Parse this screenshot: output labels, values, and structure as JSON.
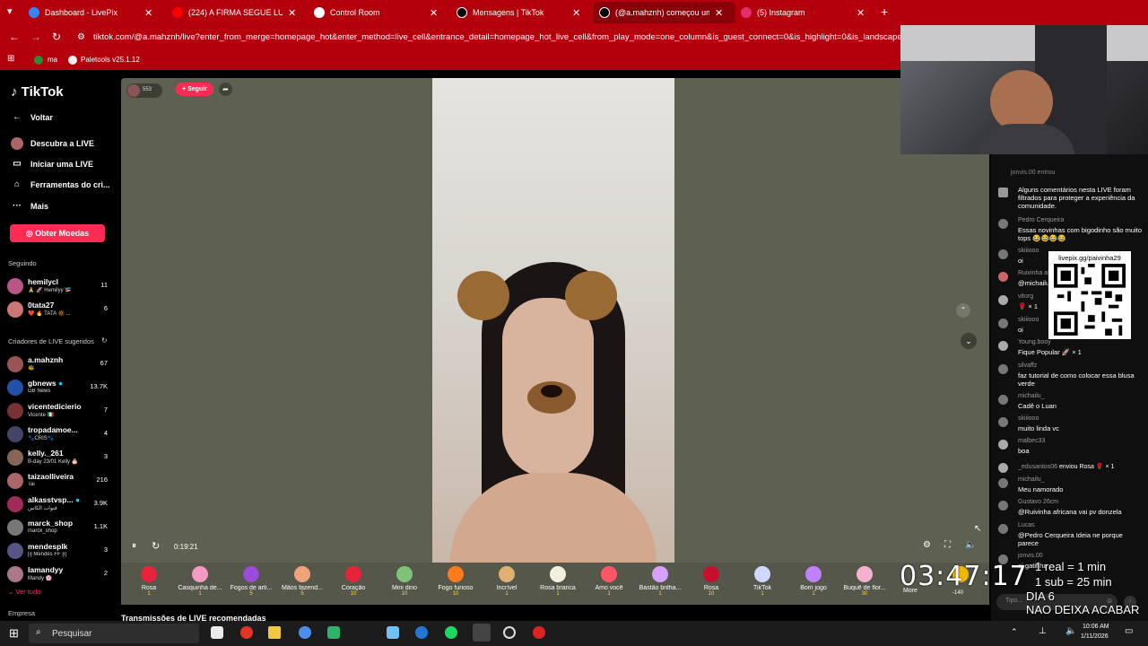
{
  "tabs": [
    {
      "label": "Dashboard - LivePix",
      "icon": "livepix-icon",
      "color": "#3a82f7"
    },
    {
      "label": "(224) A FIRMA SEGUE LUCRANDO",
      "icon": "youtube-icon",
      "color": "#ff0000"
    },
    {
      "label": "Control Room",
      "icon": "streamelements-icon",
      "color": "#ffffff"
    },
    {
      "label": "Mensagens | TikTok",
      "icon": "tiktok-icon",
      "color": "#000000"
    },
    {
      "label": "(@a.mahznh) começou um LIVE",
      "icon": "tiktok-icon",
      "color": "#000000"
    },
    {
      "label": "(5) Instagram",
      "icon": "instagram-icon",
      "color": "#e1306c"
    }
  ],
  "new_tab": "+",
  "url": "tiktok.com/@a.mahznh/live?enter_from_merge=homepage_hot&enter_method=live_cell&entrance_detail=homepage_hot_live_cell&from_play_mode=one_column&is_guest_connect=0&is_highlight=0&is_landscape=0&",
  "bookmarks": [
    "ma",
    "Paletools v25.1.12"
  ],
  "sidebar": {
    "logo": "TikTok",
    "nav": [
      "Voltar",
      "Descubra a LIVE",
      "Iniciar uma LIVE",
      "Ferramentas do cri...",
      "Mais"
    ],
    "coins": "Obter Moedas",
    "following_title": "Seguindo",
    "following": [
      {
        "name": "hemilycl",
        "sub": "🙏 🚀 Hemilyy 🎏",
        "count": "11"
      },
      {
        "name": "0tata27",
        "sub": "❤️ 🔥 TATA 🔆 ...",
        "count": "6"
      }
    ],
    "suggested_title": "Criadores de LIVE sugeridos",
    "suggested": [
      {
        "name": "a.mahznh",
        "sub": "🐝",
        "count": "67"
      },
      {
        "name": "gbnews",
        "sub": "GB News",
        "count": "13.7K"
      },
      {
        "name": "vicentedicierio",
        "sub": "Vicente 🇮🇹",
        "count": "7"
      },
      {
        "name": "tropadamoe...",
        "sub": "🐾CRIS🐾",
        "count": "4"
      },
      {
        "name": "kelly._261",
        "sub": "B-day 23/01 Kelly 🎂",
        "count": "3"
      },
      {
        "name": "taizaolliveira",
        "sub": "Tai",
        "count": "216"
      },
      {
        "name": "alkasstvsp...",
        "sub": "قنوات الكاس",
        "count": "3.9K"
      },
      {
        "name": "marck_shop",
        "sub": "marck_shop",
        "count": "1.1K"
      },
      {
        "name": "mendesplk",
        "sub": "[i] Mendes FF [i]",
        "count": "3"
      },
      {
        "name": "lamandyy",
        "sub": "Mandy 🌸",
        "count": "2"
      }
    ],
    "see_all": "Ver tudo",
    "company": "Empresa"
  },
  "player": {
    "viewers": "553",
    "follow": "+ Seguir",
    "time": "0:19:21",
    "gifts": [
      {
        "name": "Rosa",
        "price": "1",
        "color": "#e8243c"
      },
      {
        "name": "Casquinha de...",
        "price": "1",
        "color": "#f29ac4"
      },
      {
        "name": "Fogos de arti...",
        "price": "5",
        "color": "#9a4bd8"
      },
      {
        "name": "Mãos fazend...",
        "price": "5",
        "color": "#f0a27a"
      },
      {
        "name": "Coração",
        "price": "10",
        "color": "#e8243c"
      },
      {
        "name": "Mini dino",
        "price": "10",
        "color": "#7fc27a"
      },
      {
        "name": "Fogo furioso",
        "price": "10",
        "color": "#ff7a1a"
      },
      {
        "name": "Incrível",
        "price": "1",
        "color": "#e0b070"
      },
      {
        "name": "Rosa branca",
        "price": "1",
        "color": "#f4f0e0"
      },
      {
        "name": "Amo você",
        "price": "1",
        "color": "#ff5566"
      },
      {
        "name": "Bastão brilha...",
        "price": "1",
        "color": "#d8a0ff"
      },
      {
        "name": "Rosa",
        "price": "10",
        "color": "#c8102e"
      },
      {
        "name": "TikTok",
        "price": "1",
        "color": "#cfd8ff"
      },
      {
        "name": "Bom jogo",
        "price": "1",
        "color": "#c080ff"
      },
      {
        "name": "Buquê de flor...",
        "price": "30",
        "color": "#f5b0d0"
      }
    ],
    "more": "More",
    "coins_count": "-140"
  },
  "recommended": "Transmissões de LIVE recomendadas",
  "chat": {
    "top_user": "jonvis.00",
    "top_action": "entrou",
    "messages": [
      {
        "user": "",
        "text": "Alguns comentários nesta LIVE foram filtrados para proteger a experiência da comunidade."
      },
      {
        "user": "Pedro Cerqueira",
        "text": "Essas novinhas com bigodinho são muito tops 😂😂😂😂"
      },
      {
        "user": "skiiiooo",
        "text": "oi"
      },
      {
        "user": "Ruivinha af",
        "text": "@michailu_"
      },
      {
        "user": "vitorg",
        "text": "🌹 × 1"
      },
      {
        "user": "skiiiooo",
        "text": "oi"
      },
      {
        "user": "Young.booy",
        "text": "Fique Popular 🚀 × 1"
      },
      {
        "user": "silvaffz",
        "text": "faz tutorial de como colocar essa blusa verde"
      },
      {
        "user": "michailu_",
        "text": "Cadê o Luan"
      },
      {
        "user": "skiiiooo",
        "text": "muito linda vc"
      },
      {
        "user": "malbec33",
        "text": "boa"
      },
      {
        "user": "_edusantos06",
        "text": "enviou Rosa 🌹 × 1"
      },
      {
        "user": "michailu_",
        "text": "Meu namorado"
      },
      {
        "user": "Gustavo 26cm",
        "text": "@Ruivinha africana vai pv donzela"
      },
      {
        "user": "Lucas",
        "text": "@Pedro Cerqueira Ideia ne porque parece"
      },
      {
        "user": "jonvis.00",
        "text": "oi gatinha"
      }
    ],
    "input_placeholder": "Tipo..."
  },
  "qr": {
    "label": "livepix.gg/paivinha29"
  },
  "overlay": {
    "timer": "03:47:17",
    "line1": "1 real = 1 min",
    "line2": "1 sub = 25 min",
    "line3": "DIA 6",
    "line4": "NAO DEIXA ACABAR"
  },
  "taskbar": {
    "search": "Pesquisar",
    "time": "10:06 AM",
    "date": "1/11/2026"
  }
}
